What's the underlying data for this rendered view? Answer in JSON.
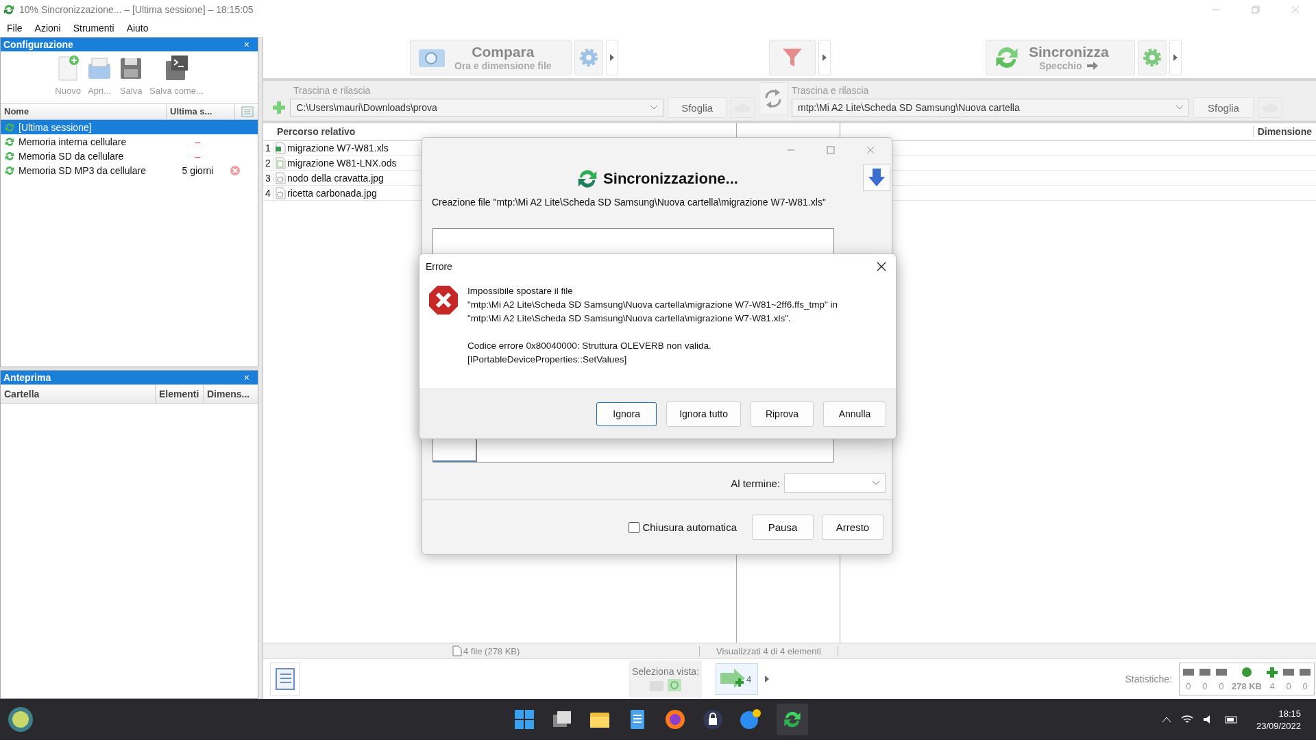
{
  "window": {
    "title": "10% Sincronizzazione... – [Ultima sessione] – 18:15:05"
  },
  "menu": [
    "File",
    "Azioni",
    "Strumenti",
    "Aiuto"
  ],
  "config_panel": {
    "title": "Configurazione",
    "close": "×",
    "toolbar": [
      {
        "label": "Nuovo",
        "kind": "new"
      },
      {
        "label": "Apri...",
        "kind": "open"
      },
      {
        "label": "Salva",
        "kind": "save"
      },
      {
        "label": "Salva come...",
        "kind": "saveas"
      }
    ],
    "columns": [
      "Nome",
      "Ultima s..."
    ],
    "rows": [
      {
        "name": "[Ultima sessione]",
        "selected": true,
        "error": false
      },
      {
        "name": "Memoria interna cellulare",
        "last": "–",
        "selected": false,
        "error": false
      },
      {
        "name": "Memoria SD da cellulare",
        "last": "–",
        "selected": false,
        "error": false
      },
      {
        "name": "Memoria SD MP3 da cellulare",
        "last": "5 giorni",
        "selected": false,
        "error": true
      }
    ]
  },
  "preview_panel": {
    "title": "Anteprima",
    "close": "×",
    "columns": [
      "Cartella",
      "Elementi",
      "Dimens..."
    ]
  },
  "compare": {
    "title": "Compara",
    "subtitle": "Ora e dimensione file"
  },
  "sync": {
    "title": "Sincronizza",
    "subtitle": "Specchio"
  },
  "left_folder": {
    "hint": "Trascina e rilascia",
    "path": "C:\\Users\\mauri\\Downloads\\prova",
    "browse": "Sfoglia"
  },
  "right_folder": {
    "hint": "Trascina e rilascia",
    "path": "mtp:\\Mi A2 Lite\\Scheda SD Samsung\\Nuova cartella",
    "browse": "Sfoglia"
  },
  "left_grid": {
    "columns": [
      "Percorso relativo"
    ],
    "rows": [
      {
        "index": "1",
        "name": "migrazione W7-W81.xls",
        "kind": "xls"
      },
      {
        "index": "2",
        "name": "migrazione W81-LNX.ods",
        "kind": "ods"
      },
      {
        "index": "3",
        "name": "nodo della cravatta.jpg",
        "kind": "jpg"
      },
      {
        "index": "4",
        "name": "ricetta carbonada.jpg",
        "kind": "jpg"
      }
    ]
  },
  "right_grid": {
    "columns": [
      "Dimensione"
    ]
  },
  "status_bar": {
    "files": "4 file (278 KB)",
    "shown": "Visualizzati 4 di 4 elementi"
  },
  "bottom_bar": {
    "view_label": "Seleziona vista:",
    "action_count": "4",
    "stats_label": "Statistiche:",
    "stats": [
      "0",
      "0",
      "0",
      "278 KB",
      "4",
      "0",
      "0"
    ]
  },
  "sync_dialog": {
    "title": "Sincronizzazione...",
    "status": "Creazione file \"mtp:\\Mi A2 Lite\\Scheda SD Samsung\\Nuova cartella\\migrazione W7-W81.xls\"",
    "level": 0.11,
    "on_finish_label": "Al termine:",
    "auto_close": {
      "label": "Chiusura automatica",
      "checked": false
    },
    "buttons": [
      "Pausa",
      "Arresto"
    ]
  },
  "error_dialog": {
    "title": "Errore",
    "paragraphs": [
      [
        "Impossibile spostare il file",
        "\"mtp:\\Mi A2 Lite\\Scheda SD Samsung\\Nuova cartella\\migrazione W7-W81~2ff6.ffs_tmp\" in",
        "\"mtp:\\Mi A2 Lite\\Scheda SD Samsung\\Nuova cartella\\migrazione W7-W81.xls\"."
      ],
      [
        "Codice errore 0x80040000: Struttura OLEVERB non valida.",
        "[IPortableDeviceProperties::SetValues]"
      ]
    ],
    "buttons": [
      {
        "label": "Ignora",
        "selected": true
      },
      {
        "label": "Ignora tutto",
        "selected": false
      },
      {
        "label": "Riprova",
        "selected": false
      },
      {
        "label": "Annulla",
        "selected": false
      }
    ]
  },
  "taskbar": {
    "time": "18:15",
    "date": "23/09/2022"
  }
}
